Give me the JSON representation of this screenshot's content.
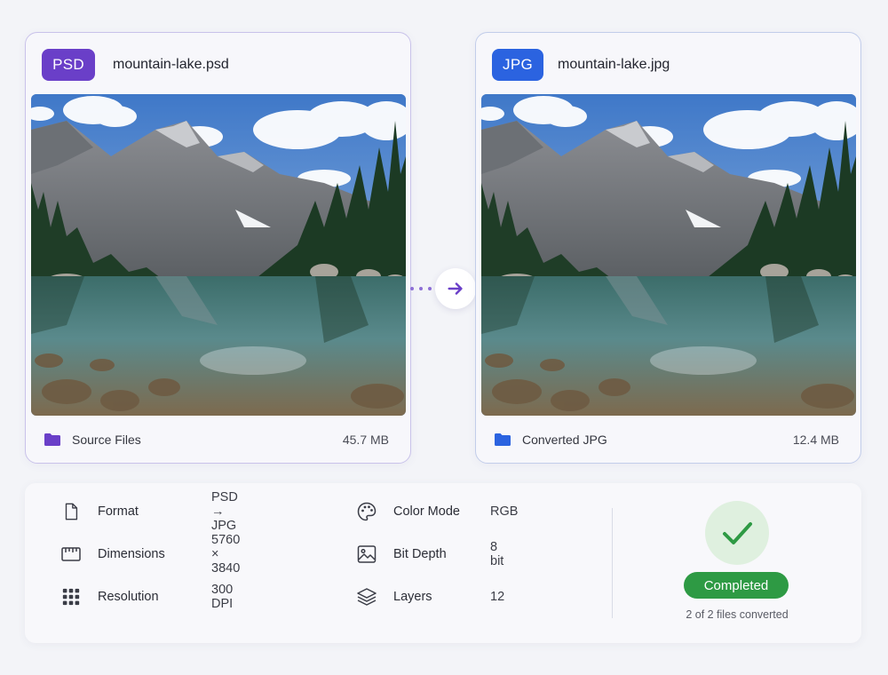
{
  "source": {
    "badge": "PSD",
    "filename": "mountain-lake.psd",
    "folder_label": "Source Files",
    "size": "45.7 MB",
    "colors": {
      "badge": "#6a3fc8",
      "folder": "#6a3fc8"
    }
  },
  "converted": {
    "badge": "JPG",
    "filename": "mountain-lake.jpg",
    "folder_label": "Converted JPG",
    "size": "12.4 MB",
    "colors": {
      "badge": "#2b63e0",
      "folder": "#2b63e0"
    }
  },
  "connector": {
    "icon": "arrow-right-icon"
  },
  "details": {
    "format": {
      "label": "Format",
      "value": "PSD → JPG",
      "icon": "file-icon"
    },
    "dimensions": {
      "label": "Dimensions",
      "value": "5760 × 3840",
      "icon": "ruler-icon"
    },
    "resolution": {
      "label": "Resolution",
      "value": "300 DPI",
      "icon": "grid-dots-icon"
    },
    "color_mode": {
      "label": "Color Mode",
      "value": "RGB",
      "icon": "palette-icon"
    },
    "bit_depth": {
      "label": "Bit Depth",
      "value": "8 bit",
      "icon": "image-icon"
    },
    "layers": {
      "label": "Layers",
      "value": "12",
      "icon": "layers-icon"
    }
  },
  "status": {
    "label": "Completed",
    "subtitle": "2 of 2 files converted",
    "icon": "check-icon",
    "colors": {
      "pill": "#2e9a44",
      "circle": "#dff0df"
    }
  }
}
